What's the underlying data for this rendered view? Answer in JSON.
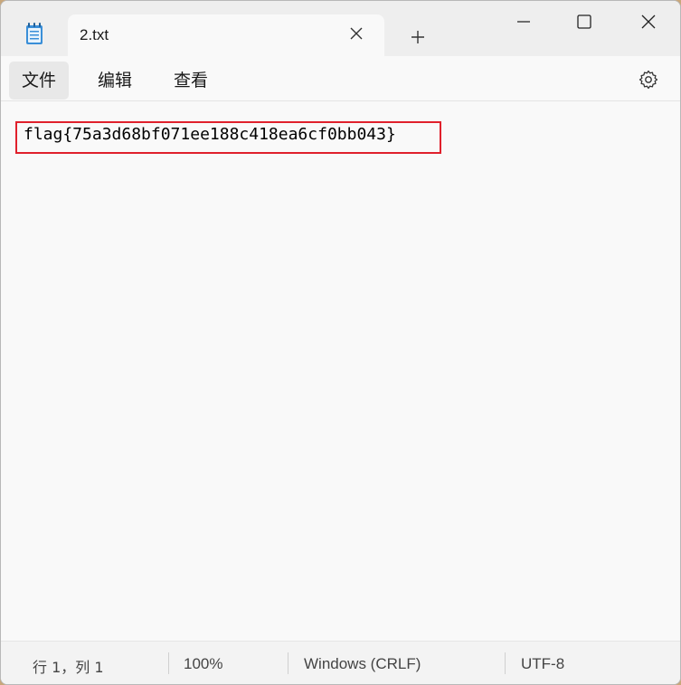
{
  "window": {
    "tab_title": "2.txt",
    "app_icon": "notepad-icon",
    "controls": [
      "minimize-icon",
      "maximize-icon",
      "close-icon"
    ],
    "new_tab_icon": "plus-icon"
  },
  "menu": {
    "file": "文件",
    "edit": "编辑",
    "view": "查看",
    "settings_icon": "gear-icon"
  },
  "editor": {
    "content": "flag{75a3d68bf071ee188c418ea6cf0bb043}",
    "highlight_color": "#e0202c"
  },
  "status": {
    "position": "行 1，列 1",
    "zoom": "100%",
    "line_ending": "Windows (CRLF)",
    "encoding": "UTF-8"
  }
}
